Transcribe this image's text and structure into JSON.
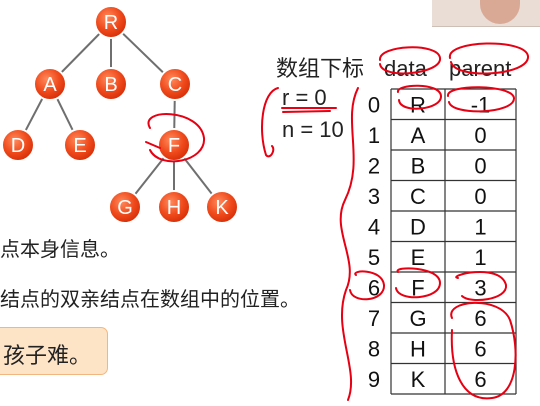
{
  "tree": {
    "nodes": [
      {
        "id": "R",
        "label": "R"
      },
      {
        "id": "A",
        "label": "A"
      },
      {
        "id": "B",
        "label": "B"
      },
      {
        "id": "C",
        "label": "C"
      },
      {
        "id": "D",
        "label": "D"
      },
      {
        "id": "E",
        "label": "E"
      },
      {
        "id": "F",
        "label": "F"
      },
      {
        "id": "G",
        "label": "G"
      },
      {
        "id": "H",
        "label": "H"
      },
      {
        "id": "K",
        "label": "K"
      }
    ],
    "edges": [
      [
        "R",
        "A"
      ],
      [
        "R",
        "B"
      ],
      [
        "R",
        "C"
      ],
      [
        "A",
        "D"
      ],
      [
        "A",
        "E"
      ],
      [
        "C",
        "F"
      ],
      [
        "F",
        "G"
      ],
      [
        "F",
        "H"
      ],
      [
        "F",
        "K"
      ]
    ]
  },
  "vars": {
    "r": "r = 0",
    "n": "n = 10"
  },
  "table": {
    "header_index": "数组下标",
    "header_data": "data",
    "header_parent": "parent",
    "rows": [
      {
        "index": "0",
        "data": "R",
        "parent": "-1"
      },
      {
        "index": "1",
        "data": "A",
        "parent": "0"
      },
      {
        "index": "2",
        "data": "B",
        "parent": "0"
      },
      {
        "index": "3",
        "data": "C",
        "parent": "0"
      },
      {
        "index": "4",
        "data": "D",
        "parent": "1"
      },
      {
        "index": "5",
        "data": "E",
        "parent": "1"
      },
      {
        "index": "6",
        "data": "F",
        "parent": "3"
      },
      {
        "index": "7",
        "data": "G",
        "parent": "6"
      },
      {
        "index": "8",
        "data": "H",
        "parent": "6"
      },
      {
        "index": "9",
        "data": "K",
        "parent": "6"
      }
    ]
  },
  "notes": {
    "line1": "点本身信息。",
    "line2": "结点的双亲结点在数组中的位置。",
    "callout": "孩子难。"
  },
  "colors": {
    "node_fill": "#ef4a1c",
    "node_stroke": "#ffffff",
    "edge": "#6f6f6f",
    "ink": "#e60012",
    "table_line": "#333333",
    "callout_bg": "#fde4c7"
  }
}
